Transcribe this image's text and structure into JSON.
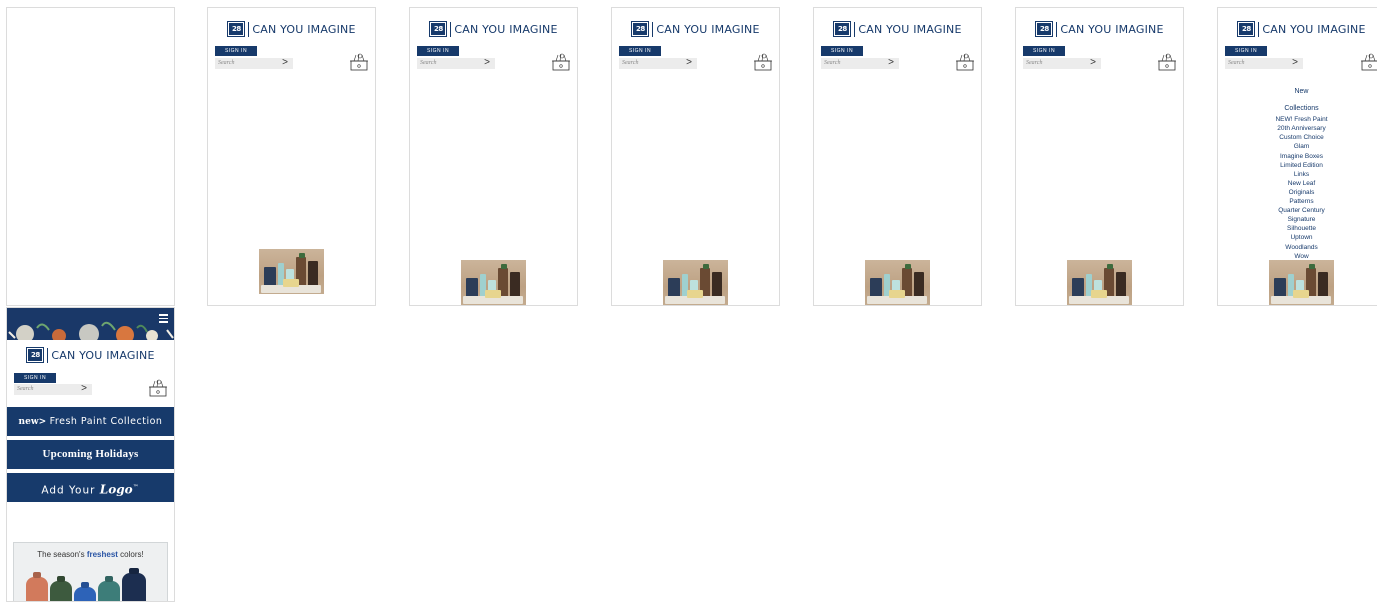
{
  "brand": {
    "logo_badge": "28",
    "logo_text": "CAN YOU IMAGINE"
  },
  "header": {
    "sign_in_label": "SIGN IN",
    "search_placeholder": "Search",
    "search_go": ">"
  },
  "frames": [
    {
      "id": "blank"
    },
    {
      "id": "frame-1"
    },
    {
      "id": "frame-2"
    },
    {
      "id": "frame-3"
    },
    {
      "id": "frame-4"
    },
    {
      "id": "frame-5"
    },
    {
      "id": "frame-6-menu"
    }
  ],
  "menu": {
    "new_label": "New",
    "collections_label": "Collections",
    "items": [
      "NEW! Fresh Paint",
      "20th Anniversary",
      "Custom Choice",
      "Glam",
      "Imagine Boxes",
      "Limited Edition",
      "Links",
      "New Leaf",
      "Originals",
      "Patterns",
      "Quarter Century",
      "Signature",
      "Silhouette",
      "Uptown",
      "Woodlands",
      "Wow"
    ]
  },
  "mobile": {
    "promo_fresh_prefix": "new>",
    "promo_fresh_rest": " Fresh Paint Collection",
    "promo_holidays": "Upcoming Holidays",
    "promo_logo_prefix": "Add Your ",
    "promo_logo_script": "Logo",
    "promo_logo_tm": "™",
    "ad_text_prefix": "The season's ",
    "ad_text_bold": "freshest",
    "ad_text_suffix": " colors!"
  },
  "colors": {
    "brand_navy": "#173a6b",
    "search_bg": "#ececec",
    "ad_accent": "#2a55a5"
  },
  "icons": [
    "basket-icon",
    "hamburger-icon",
    "search-arrow-icon",
    "logo-badge"
  ]
}
